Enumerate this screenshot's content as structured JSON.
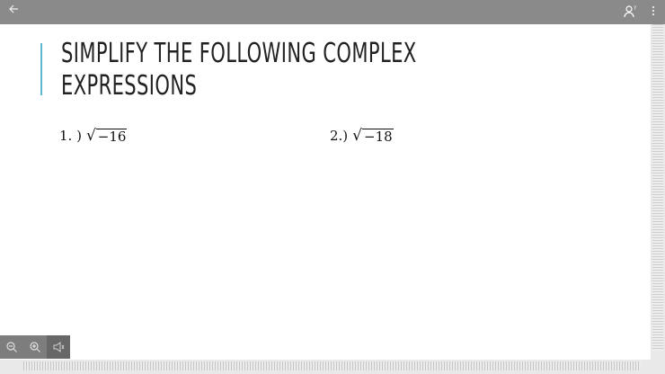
{
  "slide": {
    "title_line1": "SIMPLIFY THE FOLLOWING COMPLEX",
    "title_line2": "EXPRESSIONS",
    "problems": [
      {
        "number": "1. )",
        "radicand": "−16"
      },
      {
        "number": "2.)",
        "radicand": "−18"
      }
    ],
    "accent_color": "#5fb8cf"
  },
  "toolbar": {
    "icons": [
      "back-arrow-icon",
      "person-question-icon",
      "more-vertical-icon"
    ]
  },
  "zoom_controls": {
    "icons": [
      "zoom-out-icon",
      "zoom-in-icon",
      "speaker-icon"
    ]
  }
}
